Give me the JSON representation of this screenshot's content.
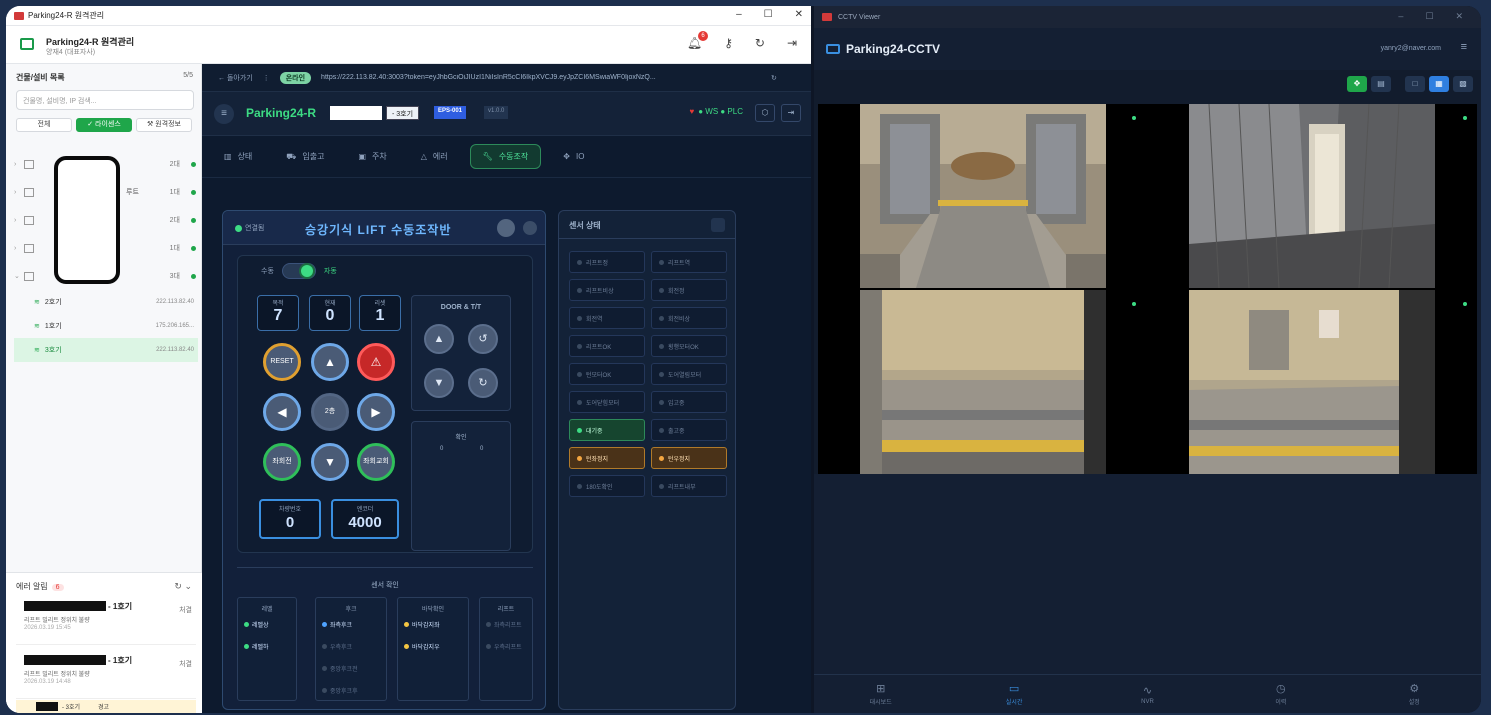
{
  "left_window": {
    "title": "Parking24-R 원격관리",
    "header_title": "Parking24-R 원격관리",
    "header_subtitle": "양재4 (대표자사)",
    "notif_count": "6",
    "sidebar": {
      "heading": "건물/설비 목록",
      "count": "5/5",
      "search_placeholder": "건물명, 설비명, IP 검색...",
      "filters": [
        "전체",
        "✓ 라이센스",
        "⚒ 원격정보"
      ],
      "rows": [
        {
          "count": "2대",
          "suffix": ""
        },
        {
          "count": "1대",
          "suffix": "루트"
        },
        {
          "count": "2대",
          "suffix": ""
        },
        {
          "count": "1대",
          "suffix": ""
        },
        {
          "count": "3대",
          "suffix": ""
        }
      ],
      "subs": [
        {
          "name": "2호기",
          "ip": "222.113.82.40"
        },
        {
          "name": "1호기",
          "ip": "175.206.165..."
        },
        {
          "name": "3호기",
          "ip": "222.113.82.40"
        }
      ],
      "alerts_title": "에러 알림",
      "alerts_count": "6",
      "alerts": [
        {
          "floor": "- 1호기",
          "desc": "리프트 밀리트 정위치 불량",
          "date": "2026.03.19 15:45",
          "action": "처결"
        },
        {
          "floor": "- 1호기",
          "desc": "리프트 밀리트 정위치 불량",
          "date": "2026.03.19 14:48",
          "action": "처결"
        }
      ],
      "last_floor": "- 3호기",
      "last_tag": "경고"
    },
    "dashboard": {
      "back": "← 돌아가기",
      "pill": "온라인",
      "url": "https://222.113.82.40:3003?token=eyJhbGciOiJIUzI1NiIsInR5cCI6IkpXVCJ9.eyJpZCI6MSwiaWF0IjoxNzQ...",
      "brand": "Parking24-R",
      "floor_label": "- 3호기",
      "eps": "EPS-001",
      "version": "v1.0.0",
      "conn": "WS ● PLC",
      "tabs": [
        "상태",
        "입출고",
        "주차",
        "에러",
        "수동조작",
        "IO"
      ],
      "panel_conn": "연결됨",
      "panel_title": "승강기식 LIFT 수동조작반",
      "toggle_left": "수동",
      "toggle_right": "자동",
      "nums": [
        {
          "label": "목적",
          "value": "7"
        },
        {
          "label": "현재",
          "value": "0"
        },
        {
          "label": "리셋",
          "value": "1"
        }
      ],
      "buttons": {
        "reset": "RESET",
        "center": "2층",
        "bl": "좌회전",
        "br": "좌회교회"
      },
      "door_title": "DOOR & T/T",
      "confirm_title": "확인",
      "car_label": "차량번호",
      "car_value": "0",
      "enc_label": "엔코더",
      "enc_value": "4000",
      "sensor_confirm": "센서 확인",
      "sensor_cols": [
        {
          "title": "레벨",
          "items": [
            {
              "t": "레벨상",
              "s": "g"
            },
            {
              "t": "레벨하",
              "s": "g"
            }
          ]
        },
        {
          "title": "후크",
          "items": [
            {
              "t": "좌측후크",
              "s": "b"
            },
            {
              "t": "우측후크",
              "s": ""
            },
            {
              "t": "중앙후크전",
              "s": ""
            },
            {
              "t": "중앙후크후",
              "s": ""
            }
          ]
        },
        {
          "title": "바닥확인",
          "items": [
            {
              "t": "바닥감지좌",
              "s": "y"
            },
            {
              "t": "바닥감지우",
              "s": "y"
            }
          ]
        },
        {
          "title": "리프트",
          "items": [
            {
              "t": "좌측리프트",
              "s": ""
            },
            {
              "t": "우측리프트",
              "s": ""
            }
          ]
        }
      ],
      "sensor_state": "센서 상태",
      "sensor_grid": [
        {
          "t": "리프트정",
          "s": ""
        },
        {
          "t": "리프트역",
          "s": ""
        },
        {
          "t": "리프트비상",
          "s": ""
        },
        {
          "t": "회전정",
          "s": ""
        },
        {
          "t": "회전역",
          "s": ""
        },
        {
          "t": "회전비상",
          "s": ""
        },
        {
          "t": "리프트OK",
          "s": ""
        },
        {
          "t": "횡행모터OK",
          "s": ""
        },
        {
          "t": "턴모터OK",
          "s": ""
        },
        {
          "t": "도어열림모터",
          "s": ""
        },
        {
          "t": "도어닫힘모터",
          "s": ""
        },
        {
          "t": "입고중",
          "s": ""
        },
        {
          "t": "대기중",
          "s": "g"
        },
        {
          "t": "출고중",
          "s": ""
        },
        {
          "t": "턴좌정지",
          "s": "o"
        },
        {
          "t": "턴우정지",
          "s": "o"
        },
        {
          "t": "180도확인",
          "s": ""
        },
        {
          "t": "리프트내부",
          "s": ""
        }
      ]
    }
  },
  "right_window": {
    "title": "CCTV Viewer",
    "header": "Parking24-CCTV",
    "user": "yanry2@naver.com",
    "nav": [
      "대시보드",
      "실시간",
      "NVR",
      "이력",
      "설정"
    ],
    "nav_icons": [
      "grid-icon",
      "camera-icon",
      "pulse-icon",
      "clock-icon",
      "gear-icon"
    ]
  }
}
